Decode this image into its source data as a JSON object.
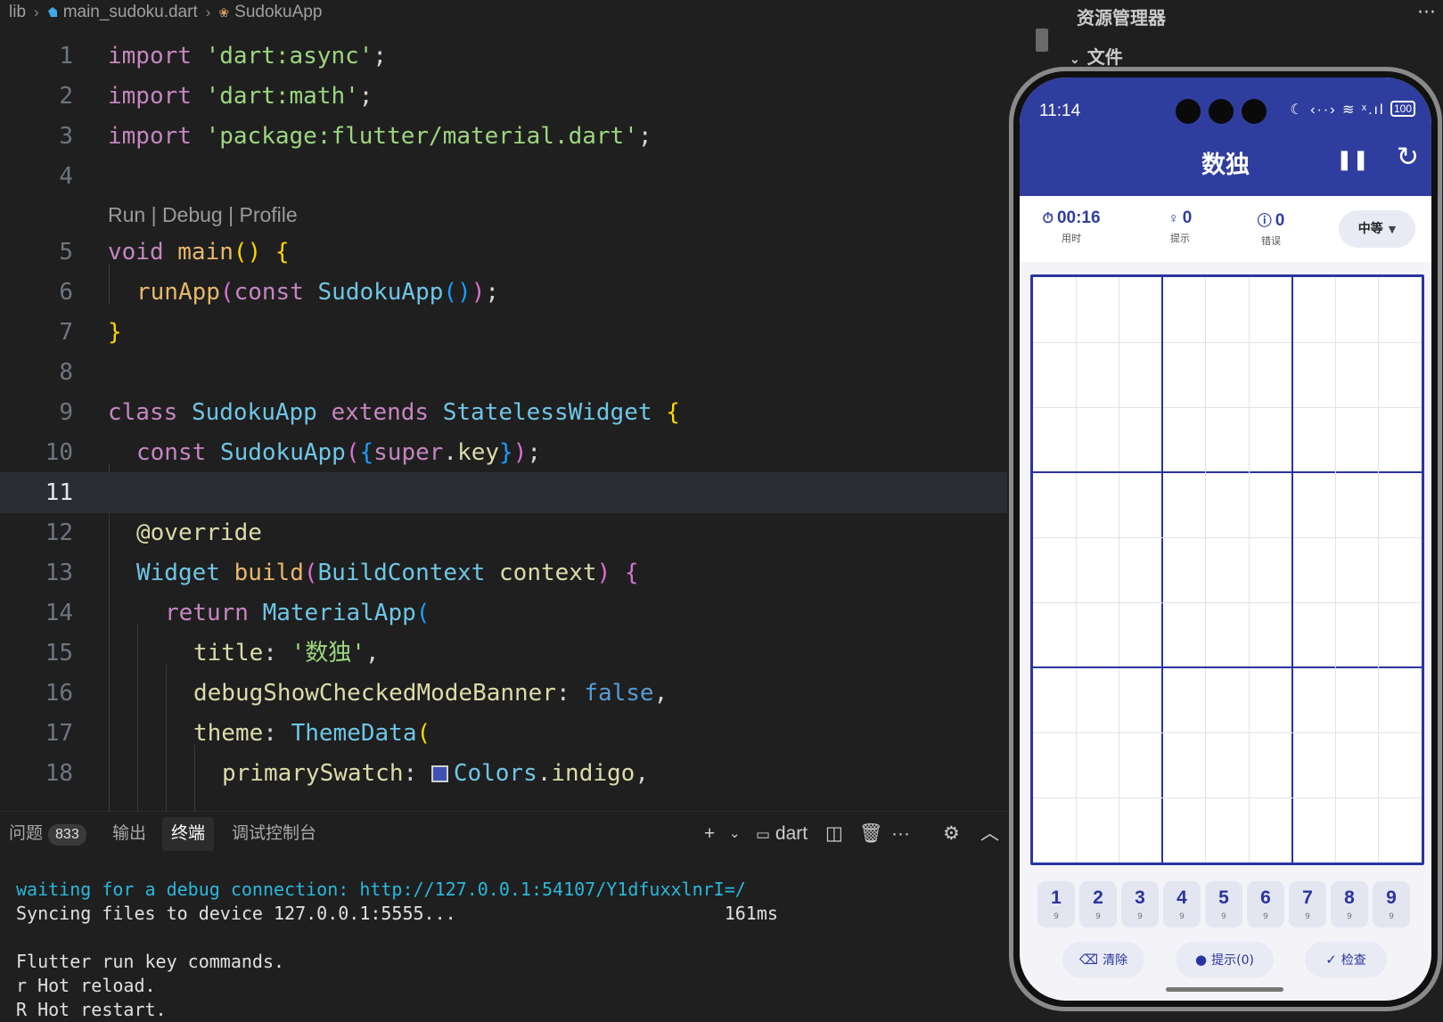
{
  "breadcrumb": {
    "root": "lib",
    "file": "main_sudoku.dart",
    "symbol": "SudokuApp"
  },
  "codelens": "Run | Debug | Profile",
  "code_lines": [
    {
      "n": "1"
    },
    {
      "n": "2"
    },
    {
      "n": "3"
    },
    {
      "n": "4"
    },
    {
      "n": "5"
    },
    {
      "n": "6"
    },
    {
      "n": "7"
    },
    {
      "n": "8"
    },
    {
      "n": "9"
    },
    {
      "n": "10"
    },
    {
      "n": "11"
    },
    {
      "n": "12"
    },
    {
      "n": "13"
    },
    {
      "n": "14"
    },
    {
      "n": "15"
    },
    {
      "n": "16"
    },
    {
      "n": "17"
    },
    {
      "n": "18"
    }
  ],
  "code_tokens": {
    "l1": [
      "import",
      " ",
      "'dart:async'",
      ";"
    ],
    "l2": [
      "import",
      " ",
      "'dart:math'",
      ";"
    ],
    "l3": [
      "import",
      " ",
      "'package:flutter/material.dart'",
      ";"
    ],
    "l5": [
      "void",
      " ",
      "main",
      "()",
      " ",
      "{"
    ],
    "l6": [
      "runApp",
      "(",
      "const",
      " ",
      "SudokuApp",
      "()",
      ")",
      ";"
    ],
    "l7": [
      "}"
    ],
    "l9": [
      "class",
      " ",
      "SudokuApp",
      " ",
      "extends",
      " ",
      "StatelessWidget",
      " ",
      "{"
    ],
    "l10": [
      "const",
      " ",
      "SudokuApp",
      "(",
      "{",
      "super",
      ".",
      "key",
      "}",
      ")",
      ";"
    ],
    "l12": [
      "@override"
    ],
    "l13": [
      "Widget",
      " ",
      "build",
      "(",
      "BuildContext",
      " ",
      "context",
      ")",
      " ",
      "{"
    ],
    "l14": [
      "return",
      " ",
      "MaterialApp",
      "("
    ],
    "l15": [
      "title",
      ": ",
      "'数独'",
      ","
    ],
    "l16": [
      "debugShowCheckedModeBanner",
      ": ",
      "false",
      ","
    ],
    "l17": [
      "theme",
      ": ",
      "ThemeData",
      "("
    ],
    "l18": [
      "primarySwatch",
      ": ",
      "Colors",
      ".",
      "indigo",
      ","
    ]
  },
  "explorer": {
    "title": "资源管理器",
    "more": "···",
    "section": "文件"
  },
  "panel": {
    "tabs": {
      "problems": "问题",
      "problems_count": "833",
      "output": "输出",
      "terminal": "终端",
      "debug_console": "调试控制台"
    },
    "tools": {
      "add": "+",
      "add_menu": "⌄",
      "shell_name": "dart",
      "more": "···",
      "collapse": "︿"
    }
  },
  "terminal": {
    "line1": "waiting for a debug connection: http://127.0.0.1:54107/Y1dfuxxlnrI=/",
    "line2": "Syncing files to device 127.0.0.1:5555...                         161ms",
    "line3": "",
    "line4": "Flutter run key commands.",
    "line5": "r Hot reload.",
    "line6": "R Hot restart."
  },
  "phone": {
    "status_time": "11:14",
    "status_icons": "☾ ‹··› ≋ ˣ.ıl",
    "battery": "100",
    "app_title": "数独",
    "stats": [
      {
        "icon": "⏱",
        "value": "00:16",
        "label": "用时"
      },
      {
        "icon": "♀",
        "value": "0",
        "label": "提示"
      },
      {
        "icon": "ⓘ",
        "value": "0",
        "label": "错误"
      }
    ],
    "difficulty": "中等",
    "numpad": [
      {
        "n": "1",
        "c": "9"
      },
      {
        "n": "2",
        "c": "9"
      },
      {
        "n": "3",
        "c": "9"
      },
      {
        "n": "4",
        "c": "9"
      },
      {
        "n": "5",
        "c": "9"
      },
      {
        "n": "6",
        "c": "9"
      },
      {
        "n": "7",
        "c": "9"
      },
      {
        "n": "8",
        "c": "9"
      },
      {
        "n": "9",
        "c": "9"
      }
    ],
    "actions": {
      "clear": "清除",
      "hint": "提示(0)",
      "check": "检查"
    }
  },
  "colors": {
    "accent": "#2f3e9e",
    "board_border": "#2a34a0",
    "swatch_indigo": "#3f51b5"
  }
}
